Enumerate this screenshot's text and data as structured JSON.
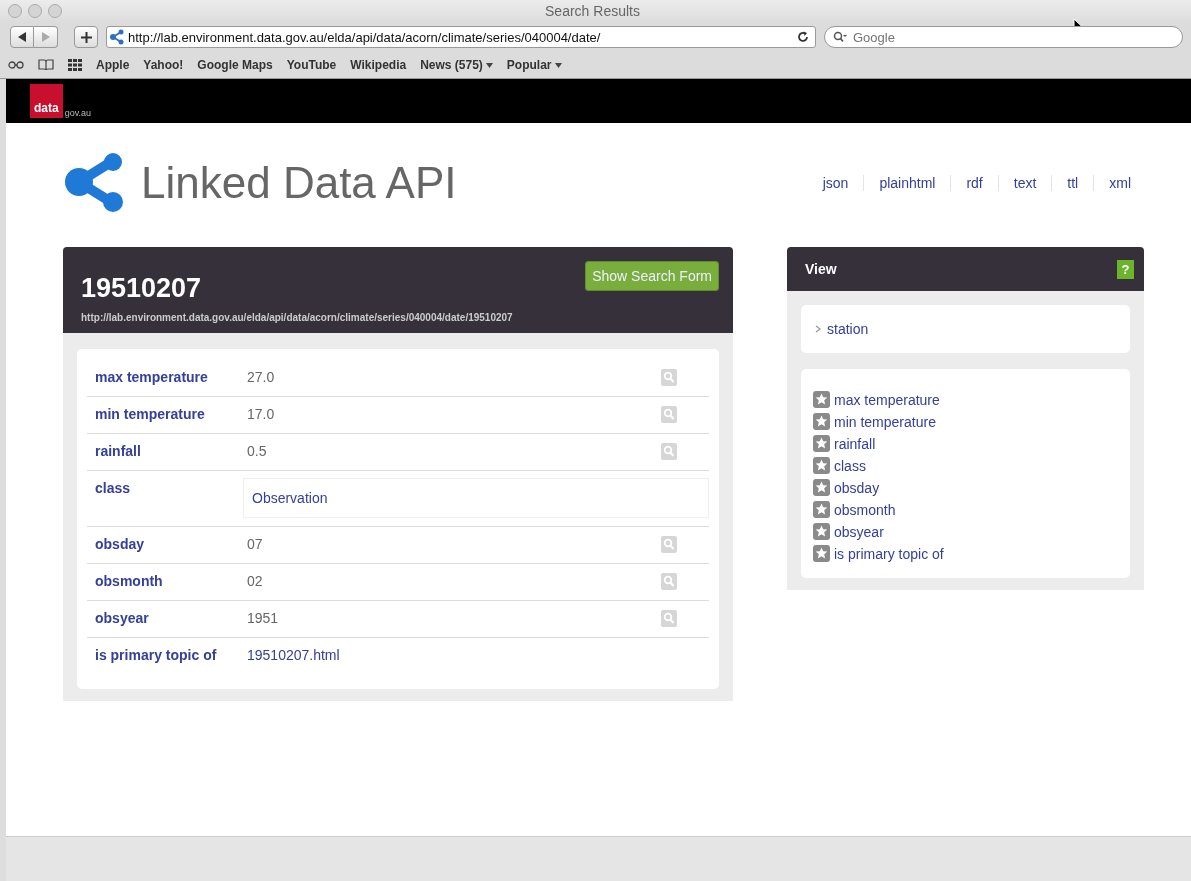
{
  "window": {
    "title": "Search Results"
  },
  "toolbar": {
    "url": "http://lab.environment.data.gov.au/elda/api/data/acorn/climate/series/040004/date/",
    "search_placeholder": "Google"
  },
  "bookmarks": [
    {
      "label": "Apple",
      "menu": false
    },
    {
      "label": "Yahoo!",
      "menu": false
    },
    {
      "label": "Google Maps",
      "menu": false
    },
    {
      "label": "YouTube",
      "menu": false
    },
    {
      "label": "Wikipedia",
      "menu": false
    },
    {
      "label": "News (575)",
      "menu": true
    },
    {
      "label": "Popular",
      "menu": true
    }
  ],
  "site_header": {
    "logo_main": "data",
    "logo_domain": "gov.au"
  },
  "api": {
    "title": "Linked Data API",
    "formats": [
      "json",
      "plainhtml",
      "rdf",
      "text",
      "ttl",
      "xml"
    ]
  },
  "resource": {
    "title": "19510207",
    "uri": "http://lab.environment.data.gov.au/elda/api/data/acorn/climate/series/040004/date/19510207",
    "search_button": "Show Search Form",
    "properties": [
      {
        "label": "max temperature",
        "value": "27.0",
        "kind": "literal"
      },
      {
        "label": "min temperature",
        "value": "17.0",
        "kind": "literal"
      },
      {
        "label": "rainfall",
        "value": "0.5",
        "kind": "literal"
      },
      {
        "label": "class",
        "value": "Observation",
        "kind": "resource"
      },
      {
        "label": "obsday",
        "value": "07",
        "kind": "literal"
      },
      {
        "label": "obsmonth",
        "value": "02",
        "kind": "literal"
      },
      {
        "label": "obsyear",
        "value": "1951",
        "kind": "literal"
      },
      {
        "label": "is primary topic of",
        "value": "19510207.html",
        "kind": "link"
      }
    ]
  },
  "view": {
    "title": "View",
    "help": "?",
    "nav": "station",
    "properties": [
      "max temperature",
      "min temperature",
      "rainfall",
      "class",
      "obsday",
      "obsmonth",
      "obsyear",
      "is primary topic of"
    ]
  }
}
